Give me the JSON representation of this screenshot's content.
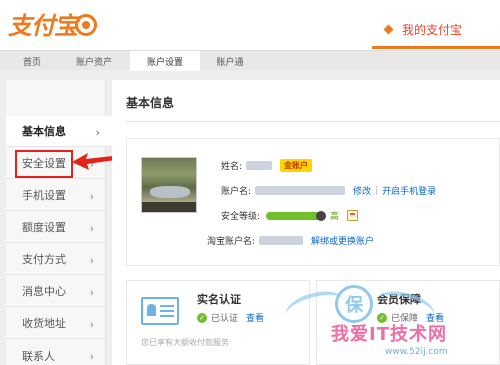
{
  "header": {
    "logo_text": "支付宝",
    "my_alipay": "我的支付宝"
  },
  "nav": {
    "tabs": [
      {
        "label": "首页"
      },
      {
        "label": "账户资产"
      },
      {
        "label": "账户设置"
      },
      {
        "label": "账户通"
      }
    ],
    "active": "账户设置"
  },
  "sidebar": {
    "items": [
      {
        "label": "基本信息"
      },
      {
        "label": "安全设置"
      },
      {
        "label": "手机设置"
      },
      {
        "label": "额度设置"
      },
      {
        "label": "支付方式"
      },
      {
        "label": "消息中心"
      },
      {
        "label": "收货地址"
      },
      {
        "label": "联系人"
      }
    ],
    "chevron": "›"
  },
  "main": {
    "title": "基本信息",
    "name_label": "姓名:",
    "gold_badge": "金账户",
    "account_label": "账户名:",
    "edit_link": "修改",
    "phone_login_link": "开启手机登录",
    "security_label": "安全等级:",
    "security_level": "高",
    "taobao_label": "淘宝账户名:",
    "bind_link": "解绑或更换账户"
  },
  "cards": {
    "realname": {
      "title": "实名认证",
      "status": "已认证",
      "view": "查看",
      "desc": "您已享有大额收付款服务"
    },
    "member": {
      "title": "会员保障",
      "status": "已保障",
      "view": "查看"
    }
  },
  "watermark": {
    "badge": "保",
    "text": "我爱IT技术网",
    "url": "www.52ij.com"
  },
  "colors": {
    "brand": "#f07a1b",
    "highlight": "#e2231a",
    "link": "#0a66c2",
    "security_bar": "#6fbf2f"
  }
}
